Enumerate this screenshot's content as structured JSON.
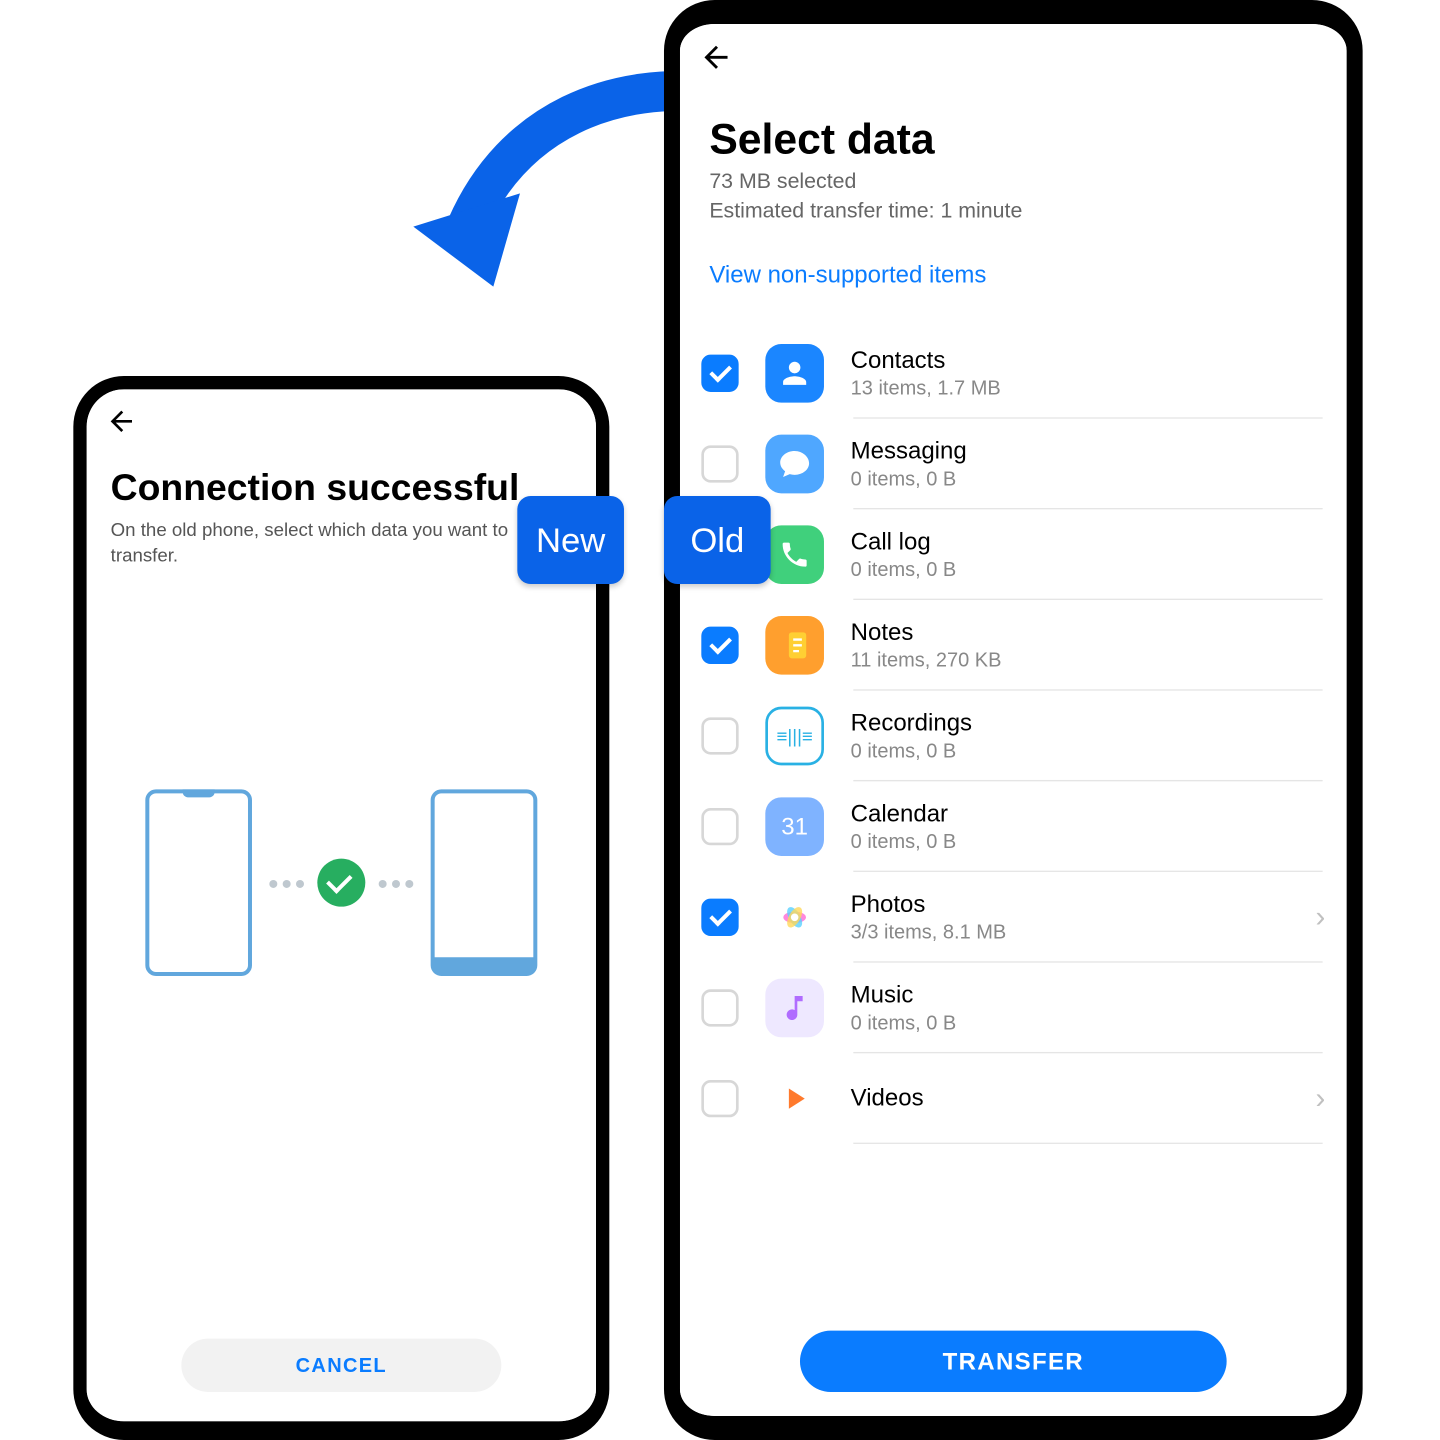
{
  "labels": {
    "new": "New",
    "old": "Old"
  },
  "small": {
    "title": "Connection successful",
    "subtitle": "On the old phone, select which data you want to transfer.",
    "cancel": "CANCEL"
  },
  "large": {
    "title": "Select data",
    "selected": "73 MB selected",
    "eta": "Estimated transfer time: 1 minute",
    "unsupported_link": "View non-supported items",
    "calendar_day": "31",
    "transfer": "TRANSFER",
    "items": [
      {
        "id": "contacts",
        "name": "Contacts",
        "detail": "13 items, 1.7 MB",
        "checked": true,
        "chevron": false
      },
      {
        "id": "messaging",
        "name": "Messaging",
        "detail": "0 items, 0 B",
        "checked": false,
        "chevron": false
      },
      {
        "id": "calllog",
        "name": "Call log",
        "detail": "0 items, 0 B",
        "checked": false,
        "chevron": false
      },
      {
        "id": "notes",
        "name": "Notes",
        "detail": "11 items, 270 KB",
        "checked": true,
        "chevron": false
      },
      {
        "id": "recordings",
        "name": "Recordings",
        "detail": "0 items, 0 B",
        "checked": false,
        "chevron": false
      },
      {
        "id": "calendar",
        "name": "Calendar",
        "detail": "0 items, 0 B",
        "checked": false,
        "chevron": false
      },
      {
        "id": "photos",
        "name": "Photos",
        "detail": "3/3 items, 8.1 MB",
        "checked": true,
        "chevron": true
      },
      {
        "id": "music",
        "name": "Music",
        "detail": "0 items, 0 B",
        "checked": false,
        "chevron": false
      },
      {
        "id": "videos",
        "name": "Videos",
        "detail": "",
        "checked": false,
        "chevron": true
      }
    ]
  }
}
